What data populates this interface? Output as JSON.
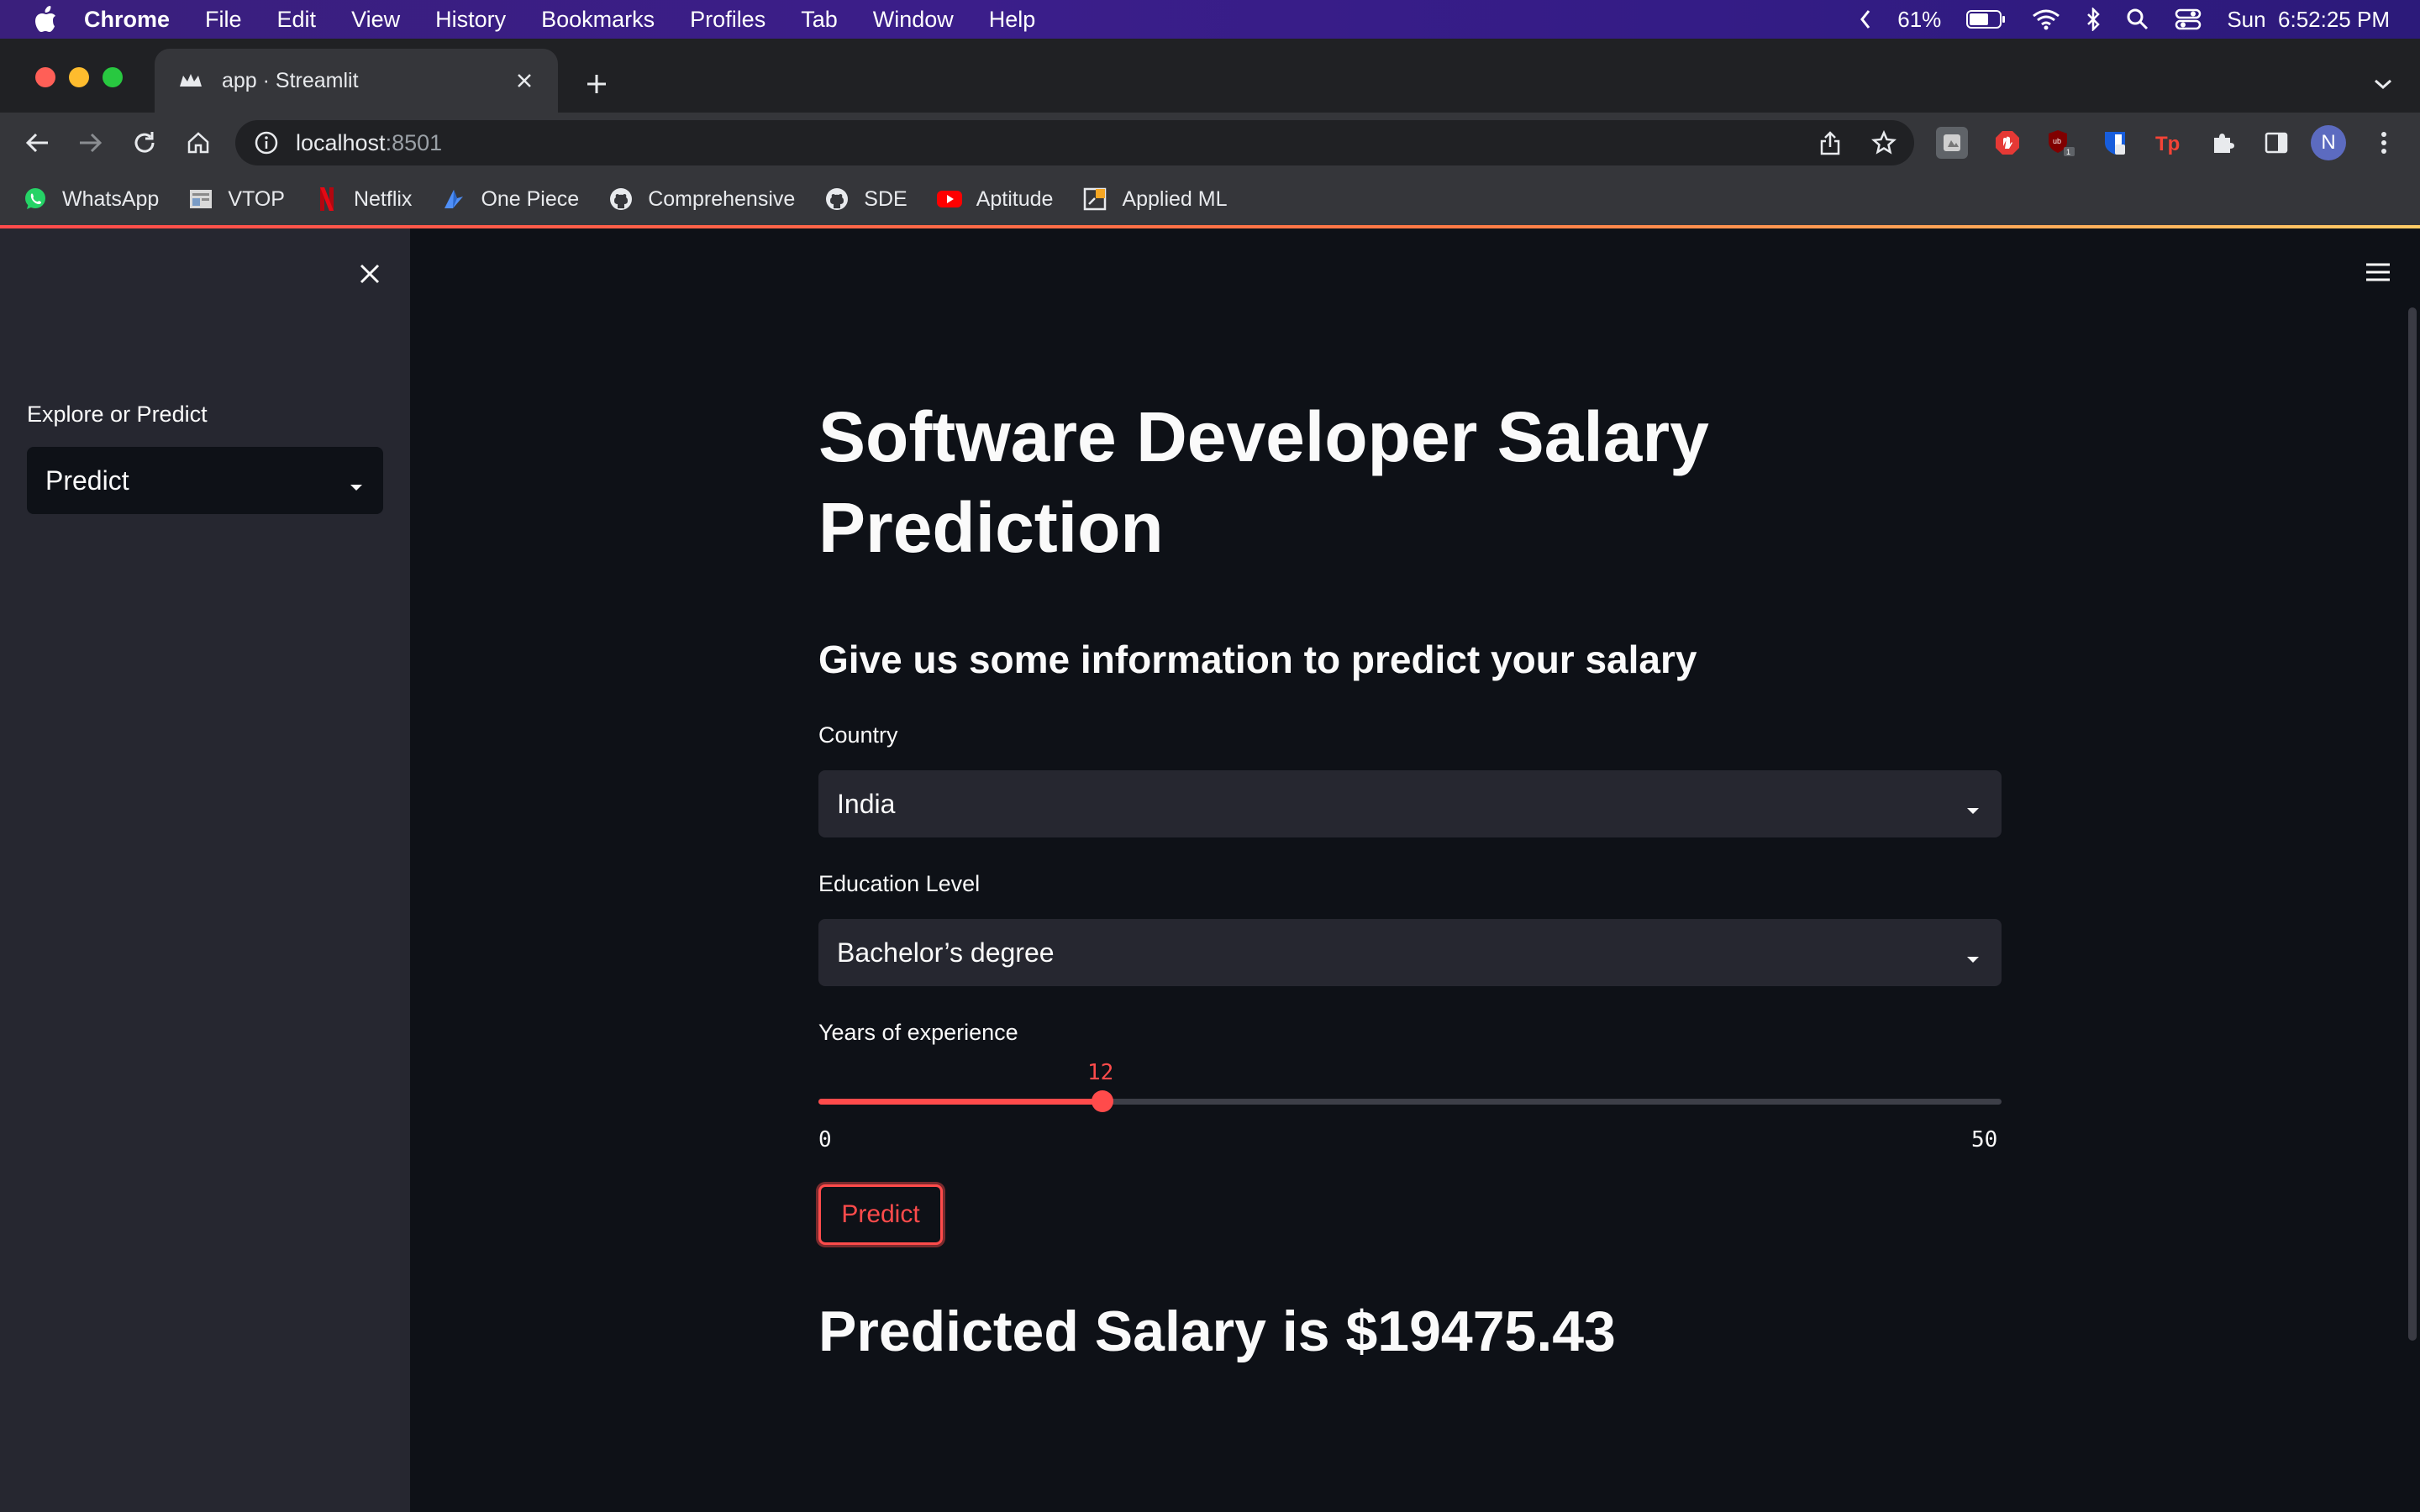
{
  "menubar": {
    "app_name": "Chrome",
    "items": [
      "File",
      "Edit",
      "View",
      "History",
      "Bookmarks",
      "Profiles",
      "Tab",
      "Window",
      "Help"
    ],
    "battery": "61%",
    "clock": "Sun  6:52:25 PM"
  },
  "browser": {
    "tab_title": "app · Streamlit",
    "url_host": "localhost",
    "url_port": ":8501",
    "avatar_initial": "N",
    "bookmarks": [
      {
        "label": "WhatsApp",
        "icon": "whatsapp-icon"
      },
      {
        "label": "VTOP",
        "icon": "vtop-icon"
      },
      {
        "label": "Netflix",
        "icon": "netflix-icon"
      },
      {
        "label": "One Piece",
        "icon": "one-piece-icon"
      },
      {
        "label": "Comprehensive",
        "icon": "github-icon"
      },
      {
        "label": "SDE",
        "icon": "github-icon"
      },
      {
        "label": "Aptitude",
        "icon": "youtube-icon"
      },
      {
        "label": "Applied ML",
        "icon": "applied-ml-icon"
      }
    ]
  },
  "sidebar": {
    "label": "Explore or Predict",
    "selected": "Predict"
  },
  "main": {
    "title": "Software Developer Salary Prediction",
    "subtitle": "Give us some information to predict your salary",
    "country_label": "Country",
    "country_value": "India",
    "education_label": "Education Level",
    "education_value": "Bachelor’s degree",
    "experience_label": "Years of experience",
    "experience_value": "12",
    "experience_min": "0",
    "experience_max": "50",
    "experience_fraction": 0.24,
    "predict_label": "Predict",
    "result": "Predicted Salary is $19475.43"
  },
  "colors": {
    "accent": "#ff4b4b",
    "background": "#0e1117",
    "sidebar": "#262730"
  }
}
